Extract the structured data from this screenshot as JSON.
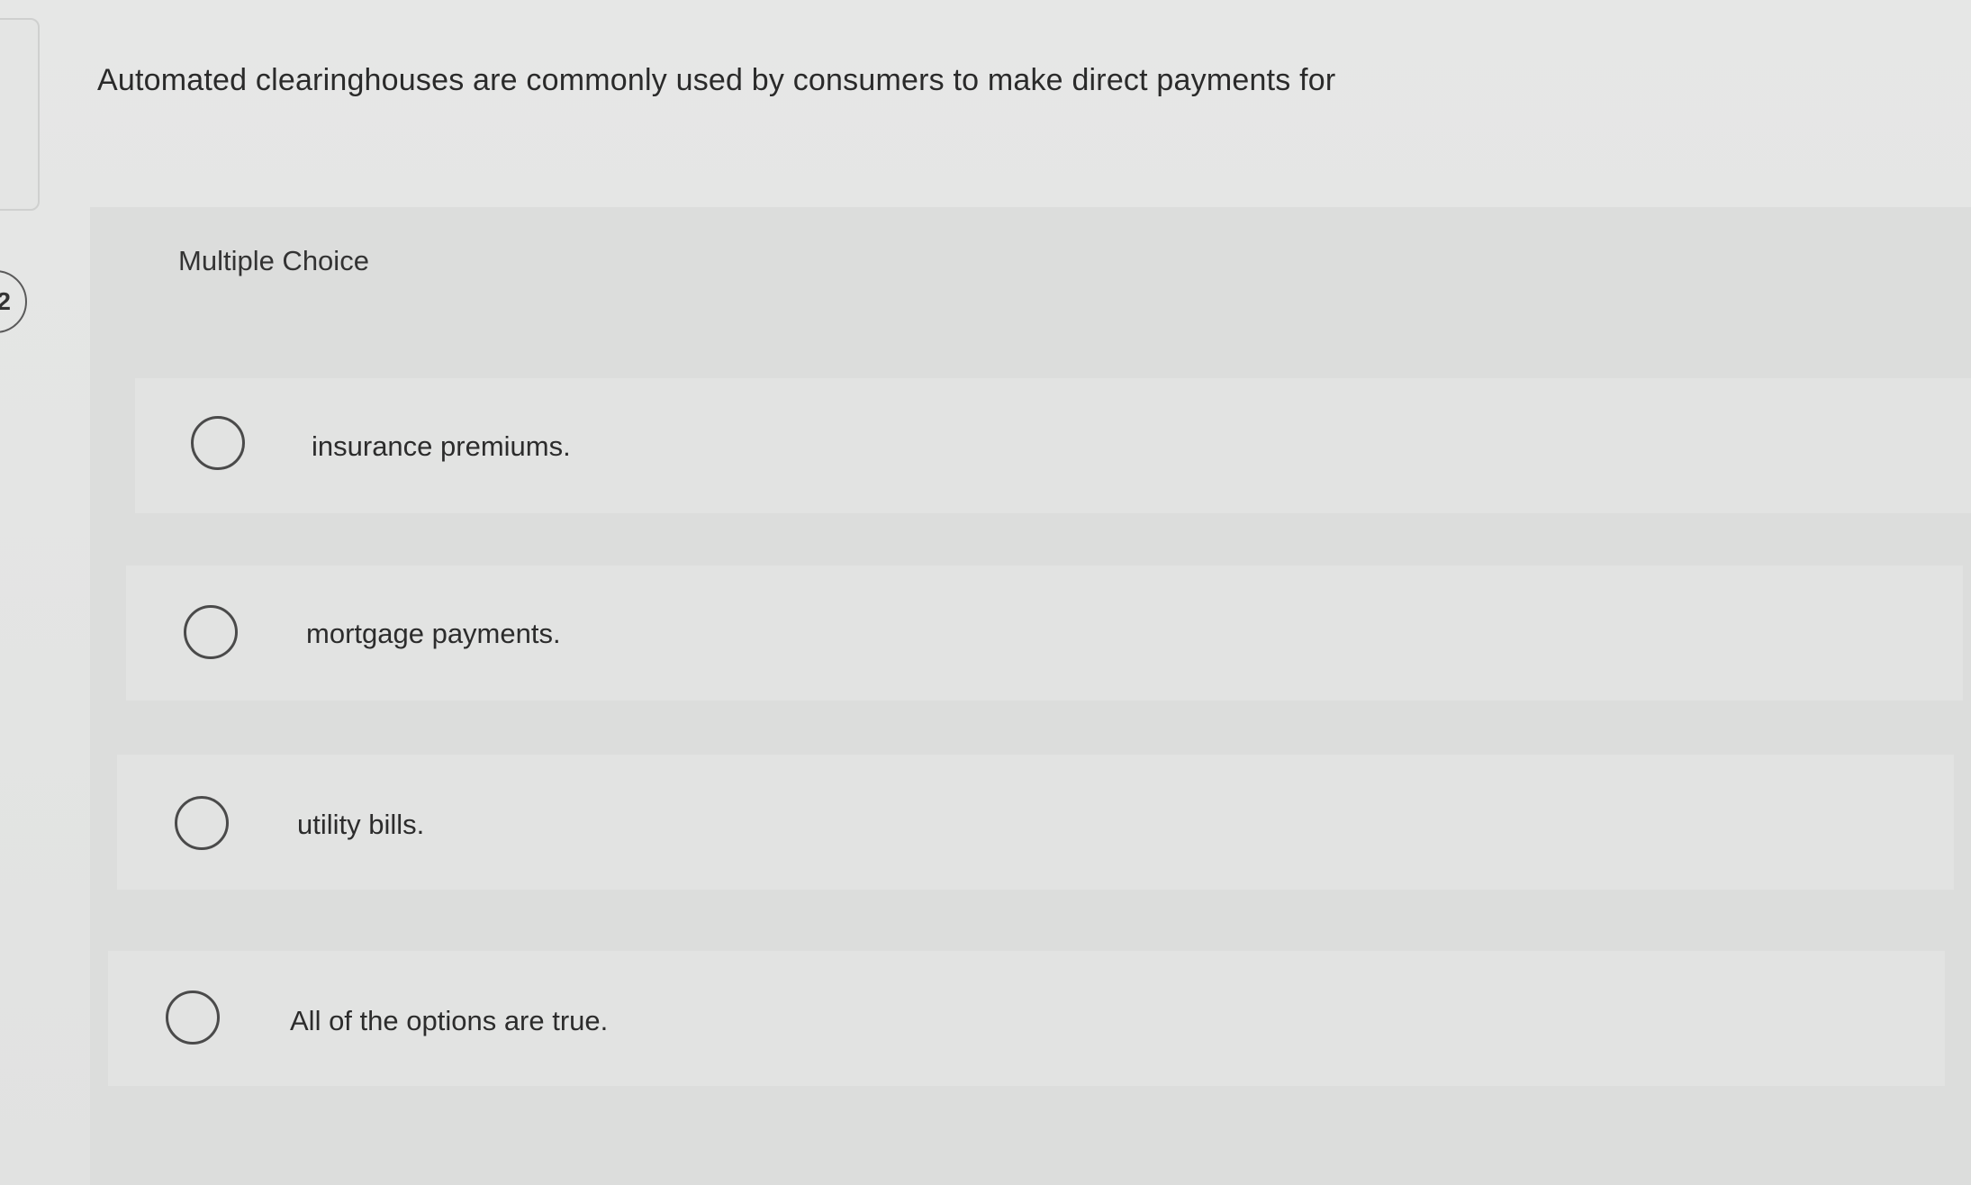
{
  "question": {
    "number": "2",
    "text": "Automated clearinghouses are commonly used by consumers to make direct payments for"
  },
  "answer_type": "Multiple Choice",
  "options": [
    {
      "label": "insurance premiums."
    },
    {
      "label": "mortgage payments."
    },
    {
      "label": "utility bills."
    },
    {
      "label": "All of the options are true."
    }
  ]
}
